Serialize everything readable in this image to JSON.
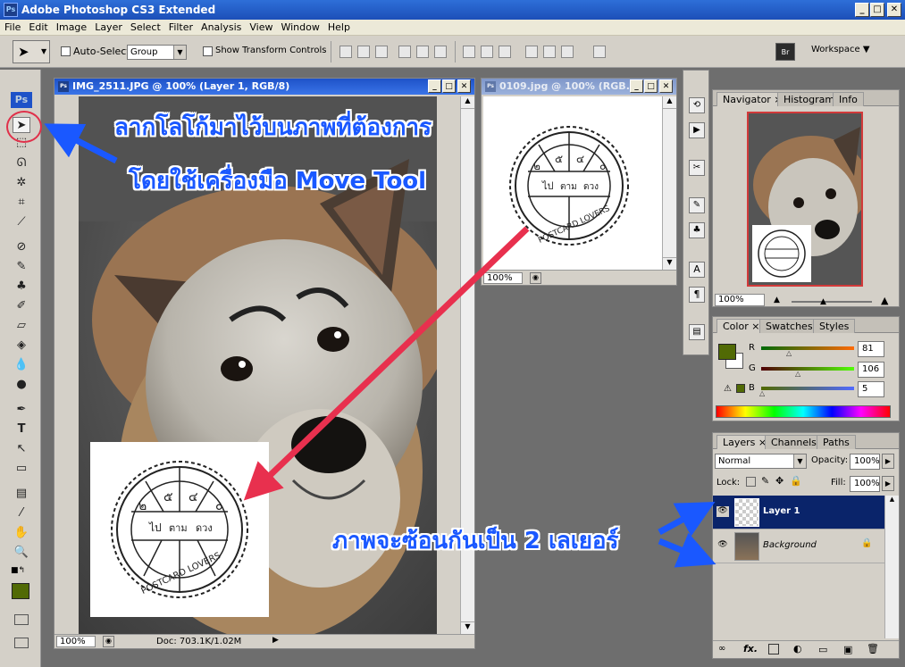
{
  "app": {
    "title": "Adobe Photoshop CS3 Extended",
    "logo": "Ps"
  },
  "menu": [
    "File",
    "Edit",
    "Image",
    "Layer",
    "Select",
    "Filter",
    "Analysis",
    "View",
    "Window",
    "Help"
  ],
  "options_bar": {
    "auto_select_label": "Auto-Select:",
    "auto_select_value": "Group",
    "transform_label": "Show Transform Controls",
    "workspace_label": "Workspace ▼"
  },
  "doc_main": {
    "title": "IMG_2511.JPG @ 100% (Layer 1, RGB/8)",
    "zoom": "100%",
    "doc_info": "Doc: 703.1K/1.02M"
  },
  "doc_second": {
    "title": "0109.jpg @ 100% (RGB...",
    "zoom": "100%"
  },
  "stamp": {
    "numbers_top": [
      "๕",
      "๔"
    ],
    "numbers_right": "๐",
    "numbers_left": "๒",
    "words": [
      "ไป",
      "ตาม",
      "ดวง"
    ],
    "ring_text": "POSTCARD LOVERS"
  },
  "navigator": {
    "tabs": [
      "Navigator",
      "Histogram",
      "Info"
    ],
    "zoom": "100%"
  },
  "color_panel": {
    "tabs": [
      "Color",
      "Swatches",
      "Styles"
    ],
    "r_label": "R",
    "g_label": "G",
    "b_label": "B",
    "r": "81",
    "g": "106",
    "b": "5",
    "foreground_hex": "#516a05"
  },
  "layers_panel": {
    "tabs": [
      "Layers",
      "Channels",
      "Paths"
    ],
    "blend_mode": "Normal",
    "opacity_label": "Opacity:",
    "opacity": "100%",
    "lock_label": "Lock:",
    "fill_label": "Fill:",
    "fill": "100%",
    "layers": [
      {
        "name": "Layer 1",
        "selected": true
      },
      {
        "name": "Background",
        "selected": false
      }
    ],
    "footer_fx": "fx."
  },
  "annotations": {
    "top_line1": "ลากโลโก้มาไว้บนภาพที่ต้องการ",
    "top_line2": "โดยใช้เครื่องมือ Move Tool",
    "bottom": "ภาพจะซ้อนกันเป็น 2 เลเยอร์"
  }
}
